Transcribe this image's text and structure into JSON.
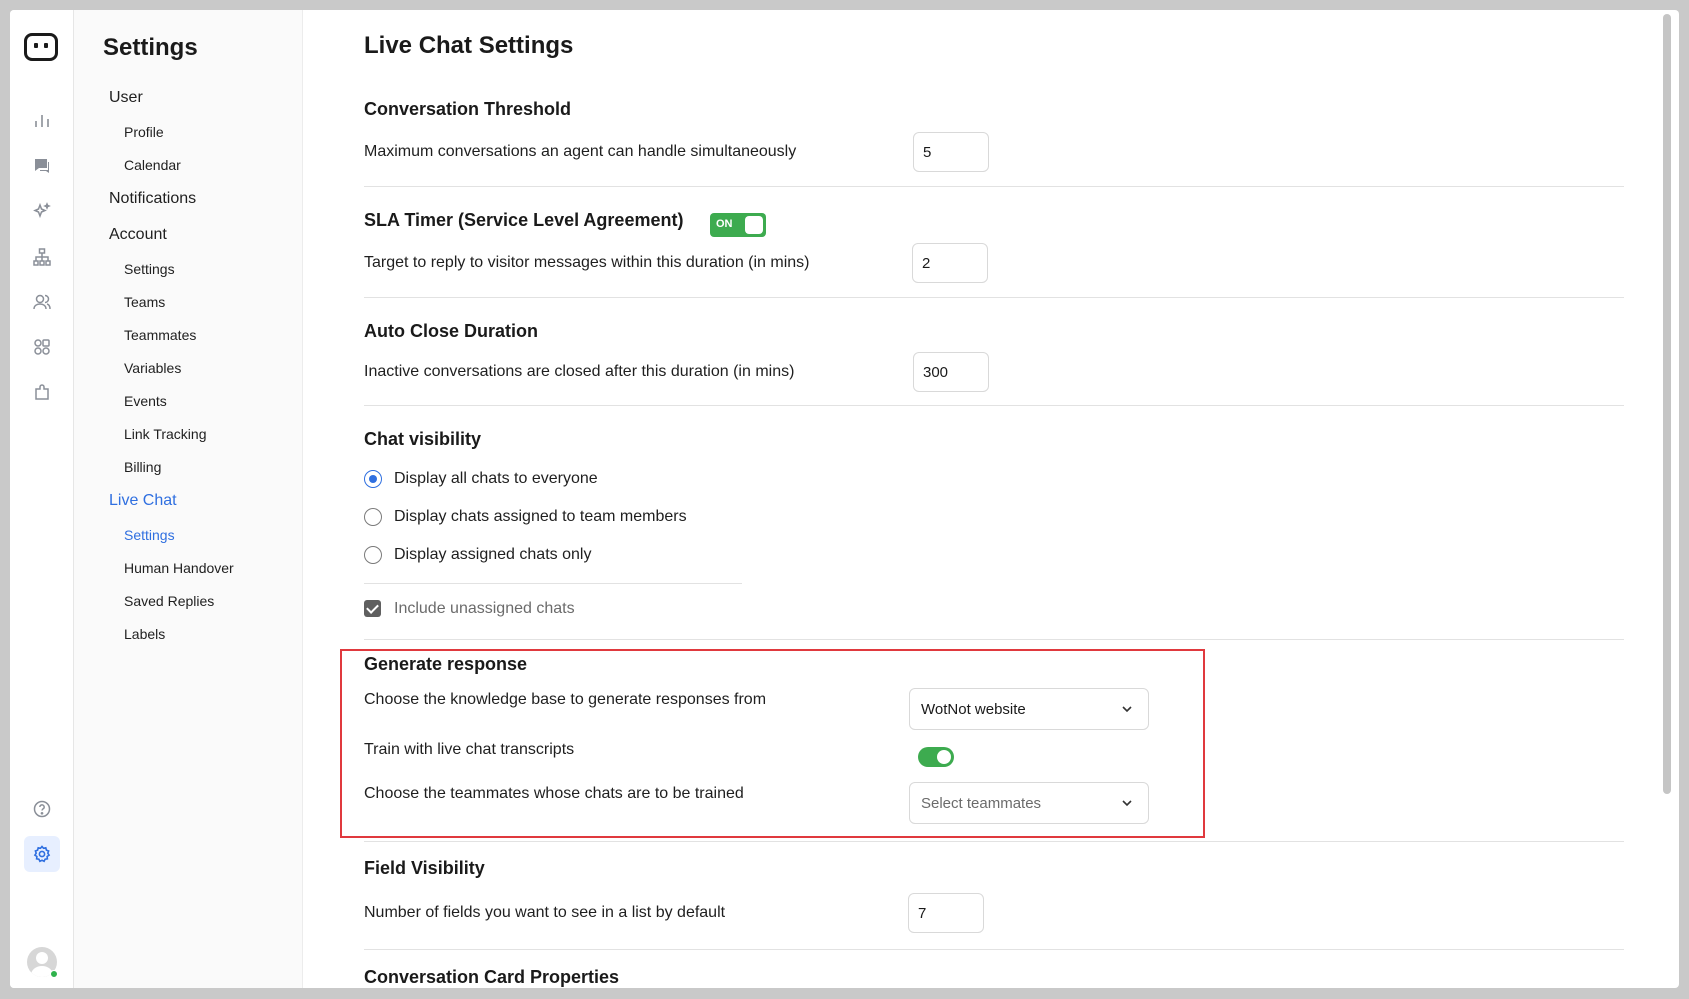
{
  "sidebar": {
    "title": "Settings",
    "groups": {
      "user": "User",
      "profile": "Profile",
      "calendar": "Calendar",
      "notifications": "Notifications",
      "account": "Account",
      "account_settings": "Settings",
      "teams": "Teams",
      "teammates": "Teammates",
      "variables": "Variables",
      "events": "Events",
      "link_tracking": "Link Tracking",
      "billing": "Billing",
      "live_chat": "Live Chat",
      "live_chat_settings": "Settings",
      "human_handover": "Human Handover",
      "saved_replies": "Saved Replies",
      "labels": "Labels"
    }
  },
  "rail": {
    "icons": [
      "logo-icon",
      "analytics-icon",
      "chat-icon",
      "ai-sparkle-icon",
      "flow-icon",
      "users-icon",
      "apps-icon",
      "integrations-icon",
      "help-icon",
      "settings-icon",
      "avatar"
    ]
  },
  "main": {
    "title": "Live Chat Settings",
    "threshold": {
      "title": "Conversation Threshold",
      "label": "Maximum conversations an agent can handle simultaneously",
      "value": "5"
    },
    "sla": {
      "title": "SLA Timer (Service Level Agreement)",
      "toggle_label": "ON",
      "label": "Target to reply to visitor messages within this duration (in mins)",
      "value": "2"
    },
    "auto_close": {
      "title": "Auto Close Duration",
      "label": "Inactive conversations are closed after this duration (in mins)",
      "value": "300"
    },
    "visibility": {
      "title": "Chat visibility",
      "options": [
        {
          "label": "Display all chats to everyone",
          "checked": true
        },
        {
          "label": "Display chats assigned to team members",
          "checked": false
        },
        {
          "label": "Display assigned chats only",
          "checked": false
        }
      ],
      "include_unassigned": "Include unassigned chats"
    },
    "generate": {
      "title": "Generate response",
      "kb_label": "Choose the knowledge base to generate responses from",
      "kb_value": "WotNot website",
      "train_label": "Train with live chat transcripts",
      "train_enabled": true,
      "teammates_label": "Choose the teammates whose chats are to be trained",
      "teammates_placeholder": "Select teammates"
    },
    "field_visibility": {
      "title": "Field Visibility",
      "label": "Number of fields you want to see in a list by default",
      "value": "7"
    },
    "card_properties": {
      "title": "Conversation Card Properties"
    }
  },
  "colors": {
    "accent": "#2f6fe0",
    "toggle_green": "#3dab4f",
    "highlight_red": "#e0393e"
  }
}
